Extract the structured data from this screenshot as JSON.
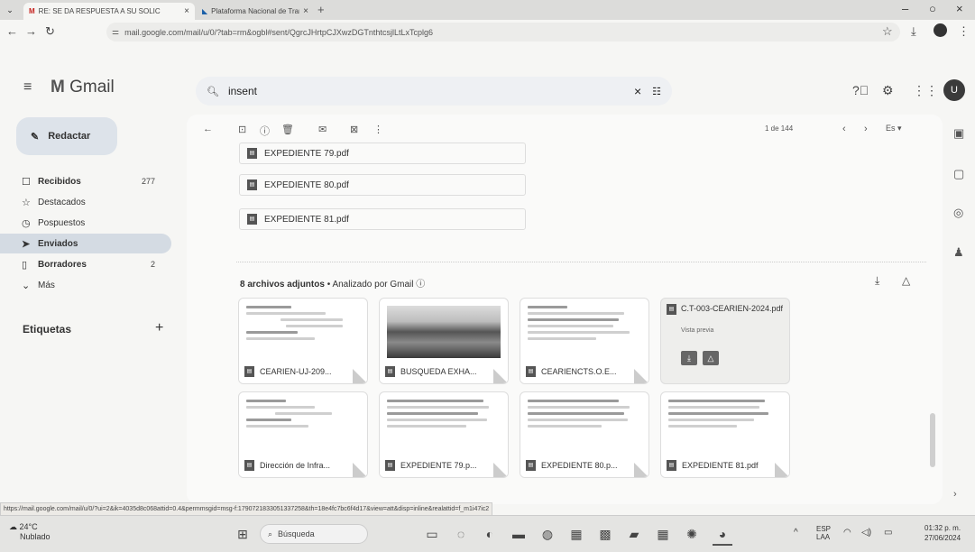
{
  "browser": {
    "tabs": [
      {
        "label": "RE: SE DA RESPUESTA A SU SOLIC",
        "icon": "gmail-icon"
      },
      {
        "label": "Plataforma Nacional de Transp",
        "icon": "platform-icon"
      }
    ],
    "url": "mail.google.com/mail/u/0/?tab=rm&ogbl#sent/QgrcJHrtpCJXwzDGTnthtcsjlLtLxTcplg6"
  },
  "gmail": {
    "logo_text": "Gmail",
    "search_value": "insent",
    "avatar_letter": "U"
  },
  "sidebar": {
    "compose_label": "Redactar",
    "items": [
      {
        "label": "Recibidos",
        "count": "277",
        "icon": "inbox-icon"
      },
      {
        "label": "Destacados",
        "count": "",
        "icon": "star-icon"
      },
      {
        "label": "Pospuestos",
        "count": "",
        "icon": "clock-icon"
      },
      {
        "label": "Enviados",
        "count": "",
        "icon": "send-icon",
        "selected": true
      },
      {
        "label": "Borradores",
        "count": "2",
        "icon": "draft-icon"
      },
      {
        "label": "Más",
        "count": "",
        "icon": "chevron-down-icon"
      }
    ],
    "labels_title": "Etiquetas"
  },
  "toolbar": {
    "pager": "1 de 144",
    "lang": "Es"
  },
  "message": {
    "attachment_rows": [
      "EXPEDIENTE 79.pdf",
      "EXPEDIENTE 80.pdf",
      "EXPEDIENTE 81.pdf"
    ],
    "summary_count": "8 archivos adjuntos",
    "summary_scanned": "Analizado por Gmail",
    "thumbnails": [
      {
        "name": "CEARIEN-UJ-209..."
      },
      {
        "name": "BUSQUEDA EXHA..."
      },
      {
        "name": "CEARIENCTS.O.E..."
      },
      {
        "name": "C.T-003-CEARIEN-2024.pdf",
        "sub": "Vista previa"
      },
      {
        "name": "Dirección de Infra..."
      },
      {
        "name": "EXPEDIENTE 79.p..."
      },
      {
        "name": "EXPEDIENTE 80.p..."
      },
      {
        "name": "EXPEDIENTE 81.pdf"
      }
    ]
  },
  "status_url": "https://mail.google.com/mail/u/0/?ui=2&ik=4035d8c068attid=0.4&permmsgid=msg-f:1790721833051337258&th=18e4fc7bc6f4d17&view=att&disp=inline&realattid=f_m1i47ic2",
  "taskbar": {
    "weather_temp": "24°C",
    "weather_desc": "Nublado",
    "search_label": "Búsqueda",
    "lang_top": "ESP",
    "lang_bottom": "LAA",
    "time": "01:32 p. m.",
    "date": "27/06/2024"
  }
}
